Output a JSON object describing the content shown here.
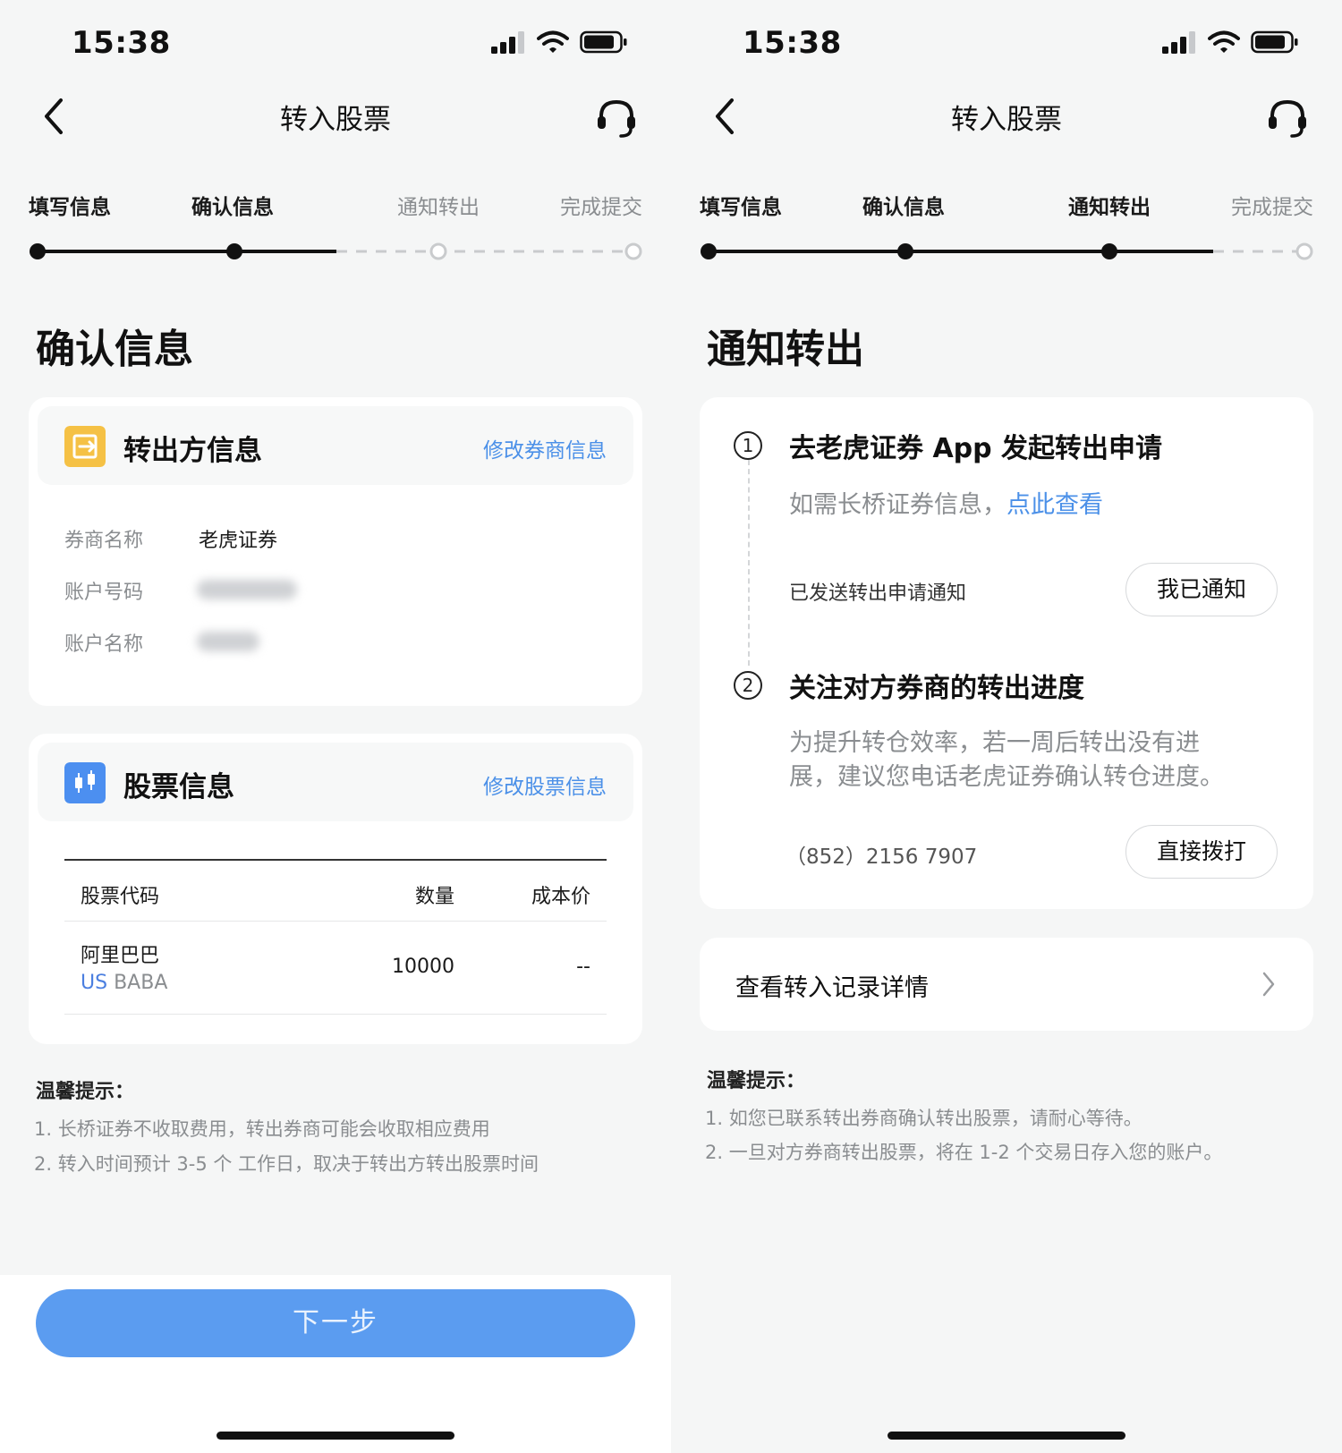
{
  "status_bar": {
    "time": "15:38"
  },
  "left": {
    "nav": {
      "title": "转入股票"
    },
    "steps": [
      {
        "label": "填写信息",
        "state": "done"
      },
      {
        "label": "确认信息",
        "state": "done"
      },
      {
        "label": "通知转出",
        "state": "todo"
      },
      {
        "label": "完成提交",
        "state": "todo"
      }
    ],
    "section_title": "确认信息",
    "transfer_out_card": {
      "title": "转出方信息",
      "edit_link": "修改券商信息",
      "icon": "exit-icon",
      "rows": [
        {
          "label": "券商名称",
          "value": "老虎证券"
        },
        {
          "label": "账户号码",
          "value": ""
        },
        {
          "label": "账户名称",
          "value": ""
        }
      ]
    },
    "stock_card": {
      "title": "股票信息",
      "edit_link": "修改股票信息",
      "icon": "candlestick-icon",
      "columns": [
        "股票代码",
        "数量",
        "成本价"
      ],
      "rows": [
        {
          "name": "阿里巴巴",
          "market": "US",
          "symbol": "BABA",
          "quantity": "10000",
          "cost": "--"
        }
      ]
    },
    "tips": {
      "title": "温馨提示：",
      "lines": [
        "1.  长桥证券不收取费用，转出券商可能会收取相应费用",
        "2.  转入时间预计 3-5 个 工作日，取决于转出方转出股票时间"
      ]
    },
    "next_button": "下一步"
  },
  "right": {
    "nav": {
      "title": "转入股票"
    },
    "steps": [
      {
        "label": "填写信息",
        "state": "done"
      },
      {
        "label": "确认信息",
        "state": "done"
      },
      {
        "label": "通知转出",
        "state": "done"
      },
      {
        "label": "完成提交",
        "state": "todo"
      }
    ],
    "section_title": "通知转出",
    "step1": {
      "number": "1",
      "title": "去老虎证券 App 发起转出申请",
      "desc_prefix": "如需长桥证券信息，",
      "desc_link": "点此查看",
      "sub": "已发送转出申请通知",
      "button": "我已通知"
    },
    "step2": {
      "number": "2",
      "title": "关注对方券商的转出进度",
      "desc_line1": "为提升转仓效率，若一周后转出没有进",
      "desc_line2": "展，建议您电话老虎证券确认转仓进度。",
      "phone": "（852）2156 7907",
      "button": "直接拨打"
    },
    "record_link": "查看转入记录详情",
    "tips": {
      "title": "温馨提示：",
      "lines": [
        "1.  如您已联系转出券商确认转出股票，请耐心等待。",
        "2.  一旦对方券商转出股票，将在 1-2 个交易日存入您的账户。"
      ]
    }
  },
  "colors": {
    "accent_blue": "#4b90e8",
    "button_blue": "#5b9cf0",
    "icon_yellow": "#f5c145",
    "icon_blue": "#4c8ff0"
  }
}
